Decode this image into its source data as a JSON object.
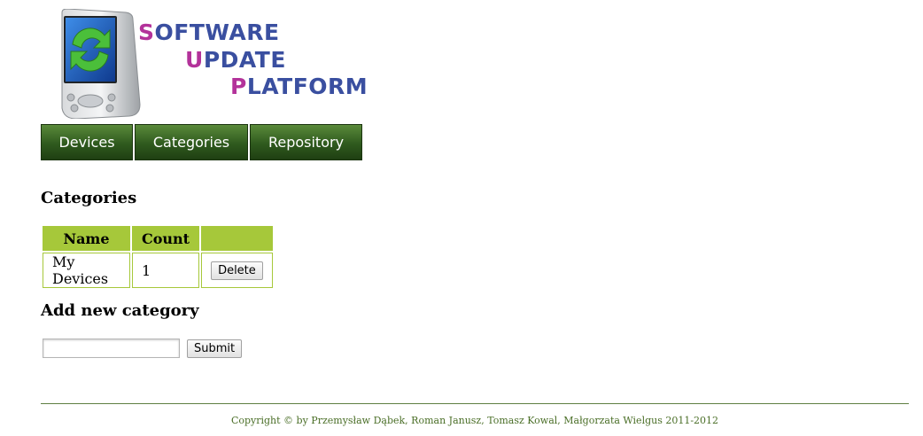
{
  "logo": {
    "line1_first": "S",
    "line1_rest": "OFTWARE",
    "line2_first": "U",
    "line2_rest": "PDATE",
    "line3_first": "P",
    "line3_rest": "LATFORM",
    "colors": {
      "accent": "#b3329a",
      "text": "#3a4fa0"
    },
    "icon": "pda-refresh-icon"
  },
  "nav": {
    "items": [
      {
        "label": "Devices"
      },
      {
        "label": "Categories"
      },
      {
        "label": "Repository"
      }
    ],
    "colors": {
      "background": "#2f5a1e",
      "text": "#ffffff"
    }
  },
  "main": {
    "heading": "Categories",
    "table": {
      "headers": [
        "Name",
        "Count",
        ""
      ],
      "rows": [
        {
          "name": "My Devices",
          "count": "1",
          "action": "Delete"
        }
      ],
      "colors": {
        "header_bg": "#a6c83a",
        "border": "#a6c83a"
      }
    },
    "add_heading": "Add new category",
    "add_input": {
      "value": "",
      "placeholder": ""
    },
    "submit_label": "Submit"
  },
  "footer": {
    "text": "Copyright © by Przemysław Dąbek, Roman Janusz, Tomasz Kowal, Małgorzata Wielgus 2011-2012",
    "color": "#4a6e27"
  }
}
